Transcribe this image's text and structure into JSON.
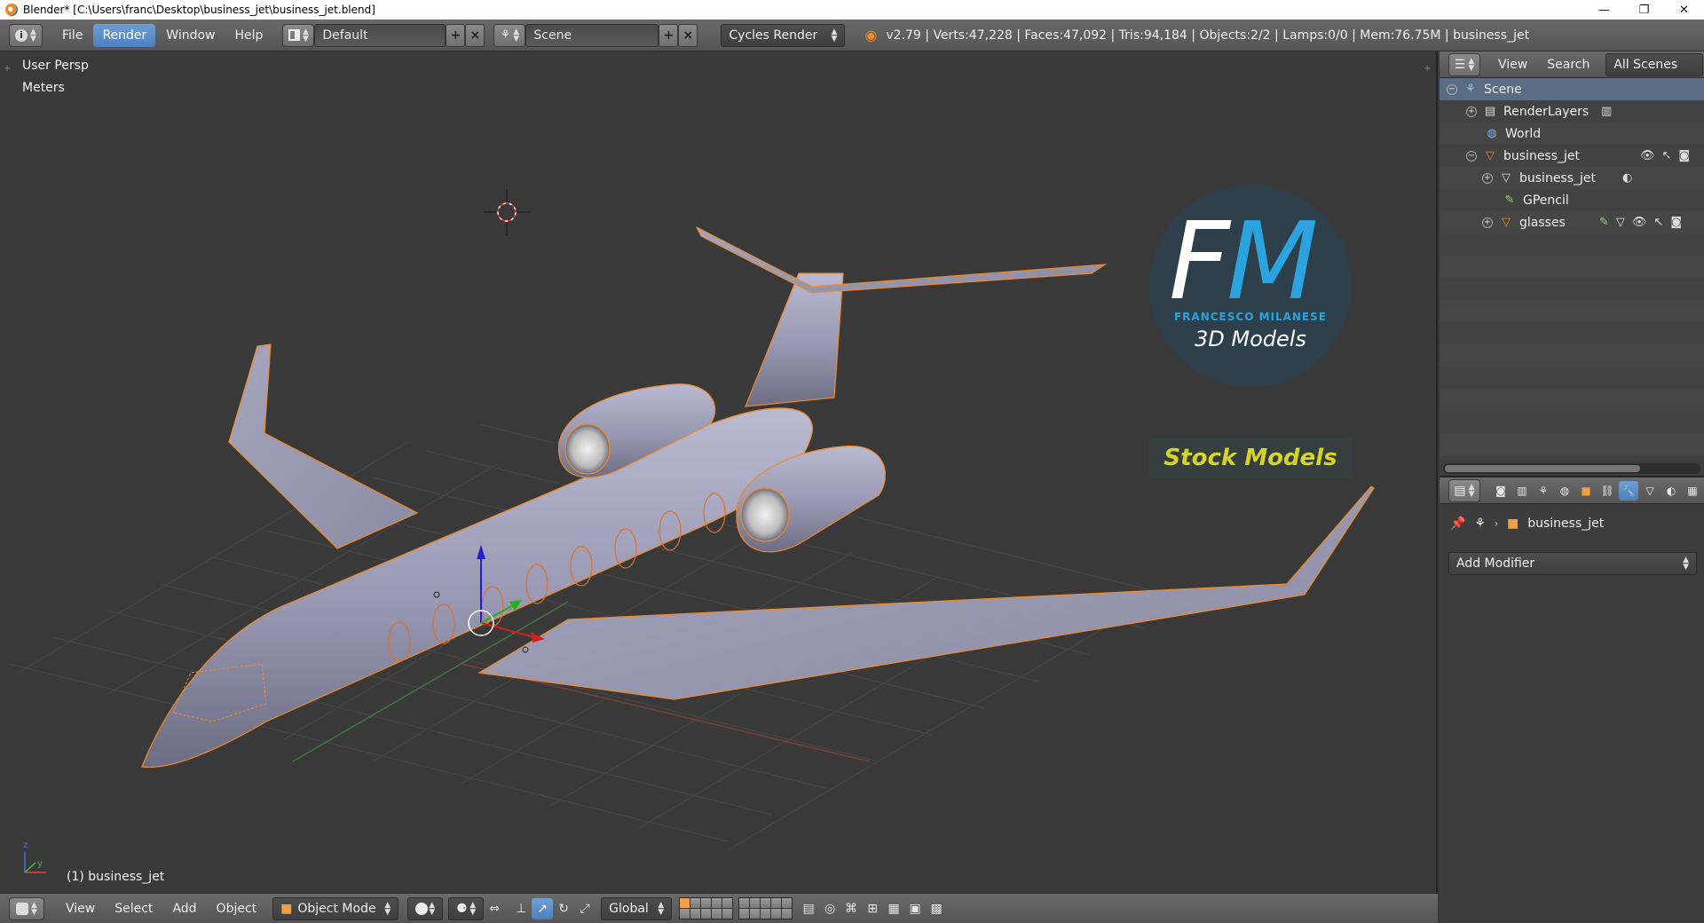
{
  "window": {
    "title": "Blender* [C:\\Users\\franc\\Desktop\\business_jet\\business_jet.blend]",
    "minimize": "—",
    "maximize": "❐",
    "close": "✕"
  },
  "topbar": {
    "menus": [
      "File",
      "Render",
      "Window",
      "Help"
    ],
    "active_menu": "Render",
    "screen_layout": "Default",
    "scene": "Scene",
    "render_engine": "Cycles Render",
    "stats": "v2.79 | Verts:47,228 | Faces:47,092 | Tris:94,184 | Objects:2/2 | Lamps:0/0 | Mem:76.75M | business_jet"
  },
  "viewport": {
    "view_label": "User Persp",
    "units_label": "Meters",
    "object_label": "(1) business_jet"
  },
  "watermark": {
    "f": "F",
    "m": "M",
    "name": "FRANCESCO MILANESE",
    "sub": "3D Models",
    "stock": "Stock Models"
  },
  "bottombar": {
    "menus": [
      "View",
      "Select",
      "Add",
      "Object"
    ],
    "mode": "Object Mode",
    "orientation": "Global"
  },
  "outliner": {
    "menus": [
      "View",
      "Search"
    ],
    "filter": "All Scenes",
    "rows": [
      {
        "label": "Scene"
      },
      {
        "label": "RenderLayers"
      },
      {
        "label": "World"
      },
      {
        "label": "business_jet"
      },
      {
        "label": "business_jet"
      },
      {
        "label": "GPencil"
      },
      {
        "label": "glasses"
      }
    ]
  },
  "properties": {
    "context_object": "business_jet",
    "add_modifier": "Add Modifier"
  },
  "colors": {
    "accent": "#5680c2",
    "selection_outline": "#f08a24",
    "viewport_bg": "#393939",
    "brand_blue": "#2ba3df",
    "brand_yellow": "#d6d32a"
  }
}
